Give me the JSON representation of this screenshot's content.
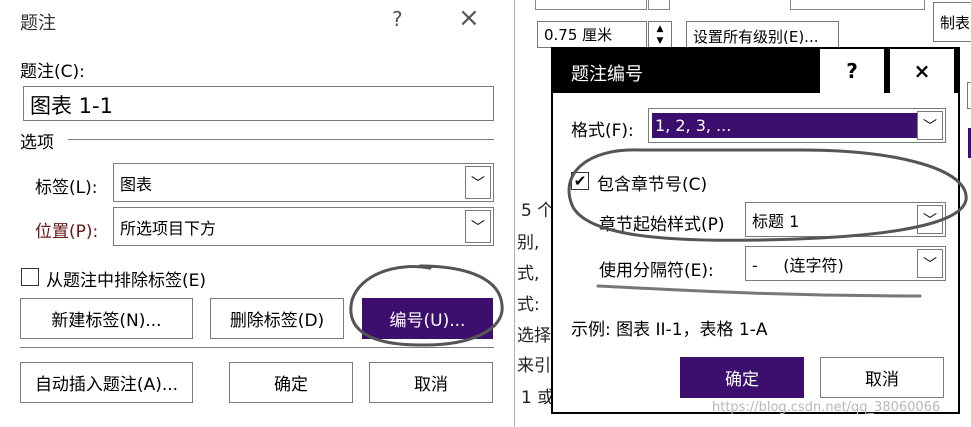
{
  "background_doc": {
    "unit_value": "0.75 厘米",
    "set_all_levels": "设置所有级别(E)...",
    "edge_button": "制表",
    "lines": [
      "5 个",
      "别,",
      "式,",
      "式:",
      "选择",
      "来引",
      "1 或"
    ]
  },
  "caption_dialog": {
    "title": "题注",
    "help": "?",
    "close": "×",
    "caption_label": "题注(C):",
    "caption_value": "图表 1-1",
    "options_header": "选项",
    "label_label": "标签(L):",
    "label_value": "图表",
    "position_label": "位置(P):",
    "position_value": "所选项目下方",
    "exclude_label": "从题注中排除标签(E)",
    "exclude_checked": false,
    "new_label_button": "新建标签(N)...",
    "delete_label_button": "删除标签(D)",
    "numbering_button": "编号(U)...",
    "auto_insert_button": "自动插入题注(A)...",
    "ok_button": "确定",
    "cancel_button": "取消"
  },
  "numbering_dialog": {
    "title": "题注编号",
    "help": "?",
    "close": "×",
    "format_label": "格式(F):",
    "format_value": "1, 2, 3, ...",
    "include_chapter_label": "包含章节号(C)",
    "include_chapter_checked": true,
    "chapter_style_label": "章节起始样式(P)",
    "chapter_style_value": "标题 1",
    "separator_label": "使用分隔符(E):",
    "separator_value": "-     (连字符)",
    "example_text": "示例:  图表 II-1，表格 1-A",
    "ok_button": "确定",
    "cancel_button": "取消"
  },
  "watermark": "https://blog.csdn.net/qq_38060066",
  "colors": {
    "accent": "#3c0e6e",
    "title_bar": "#000000"
  }
}
